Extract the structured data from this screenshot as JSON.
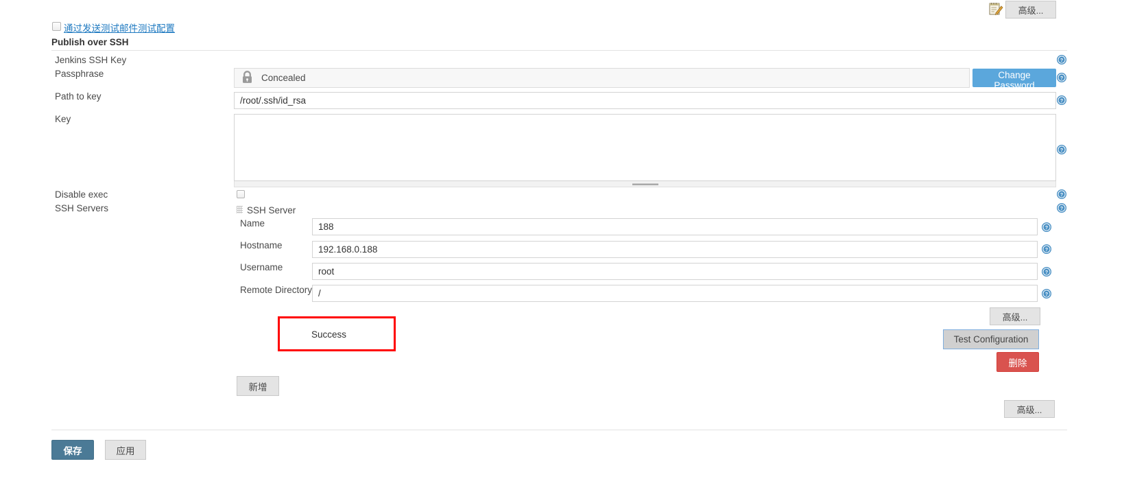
{
  "top": {
    "notepad_icon": "notepad-edit-icon",
    "advanced_label": "高级..."
  },
  "test_mail": {
    "checkbox_icon": "checkbox-unchecked-icon",
    "link_label": "通过发送测试邮件测试配置"
  },
  "section": {
    "title": "Publish over SSH"
  },
  "fields": {
    "jenkins_ssh_key_label": "Jenkins SSH Key",
    "passphrase_label": "Passphrase",
    "passphrase_value": "Concealed",
    "lock_icon": "lock-icon",
    "change_password_label": "Change Password",
    "path_to_key_label": "Path to key",
    "path_to_key_value": "/root/.ssh/id_rsa",
    "key_label": "Key",
    "key_value": "",
    "key_placeholder": "",
    "disable_exec_label": "Disable exec",
    "disable_exec_icon": "checkbox-unchecked-icon",
    "ssh_servers_label": "SSH Servers"
  },
  "ssh_server": {
    "drag_handle_icon": "drag-handle-icon",
    "title": "SSH Server",
    "name_label": "Name",
    "name_value": "188",
    "hostname_label": "Hostname",
    "hostname_value": "192.168.0.188",
    "username_label": "Username",
    "username_value": "root",
    "remote_directory_label": "Remote Directory",
    "remote_directory_value": "/",
    "advanced_label": "高级...",
    "test_configuration_label": "Test Configuration",
    "delete_label": "删除",
    "test_result": "Success",
    "add_label": "新增"
  },
  "bottom": {
    "advanced_label": "高级...",
    "save_label": "保存",
    "apply_label": "应用"
  },
  "help": {
    "icon": "help-question-icon"
  },
  "colors": {
    "link": "#1f7ac1",
    "primary_button": "#5ba7dc",
    "save_button": "#4b7a96",
    "delete_button": "#d9534f",
    "annotation_border": "#ff0000",
    "help_icon": "#4a90c4"
  }
}
